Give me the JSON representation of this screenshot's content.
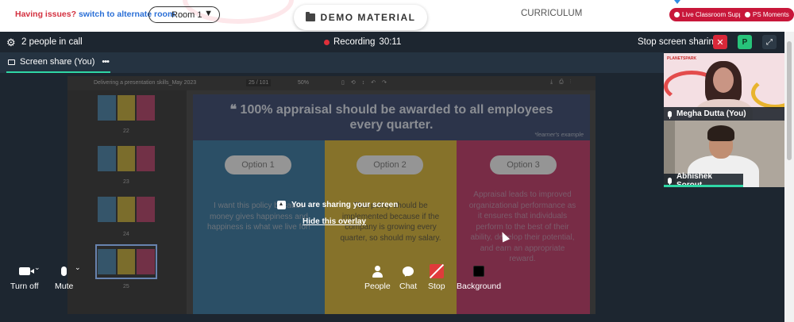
{
  "top": {
    "issues_text": "Having issues?",
    "switch_link": "switch to alternate room",
    "room_select": "Room 1",
    "demo_material": "DEMO MATERIAL",
    "curriculum": "CURRICULUM",
    "live_support": "Live Classroom Support",
    "ps_moments": "PS Moments"
  },
  "call": {
    "people_count": "2 people in call",
    "recording_label": "Recording",
    "recording_time": "30:11",
    "stop_share": "Stop screen sharing",
    "avatar_letter": "P",
    "tab_label": "Screen share (You)",
    "overlay_message": "You are sharing your screen",
    "overlay_link": "Hide this overlay"
  },
  "pdf": {
    "title": "Delivering a presentation skills_May 2023",
    "page": "25 / 101",
    "zoom": "50%",
    "thumb_numbers": [
      "22",
      "23",
      "24",
      "25"
    ]
  },
  "slide": {
    "title": "❝ 100% appraisal should be awarded to all employees every quarter.",
    "note": "*learner's example",
    "options": [
      {
        "label": "Option 1",
        "text": "I want this policy because money gives happiness and happiness is what we live for!"
      },
      {
        "label": "Option 2",
        "text": "This policy should be implemented because if the company is growing every quarter, so should my salary."
      },
      {
        "label": "Option 3",
        "text": "Appraisal leads to improved organizational performance as it ensures that individuals perform to the best of their ability, develop their potential, and earn an appropriate reward."
      }
    ]
  },
  "participants": [
    {
      "name": "Megha Dutta (You)"
    },
    {
      "name": "Abhishek Sorout"
    }
  ],
  "controls": {
    "turn_off": "Turn off",
    "mute": "Mute",
    "people": "People",
    "chat": "Chat",
    "stop": "Stop",
    "background": "Background"
  },
  "colors": {
    "accent_green": "#2fd7a5",
    "recording_red": "#e0303a",
    "support_red": "#c8173a"
  }
}
